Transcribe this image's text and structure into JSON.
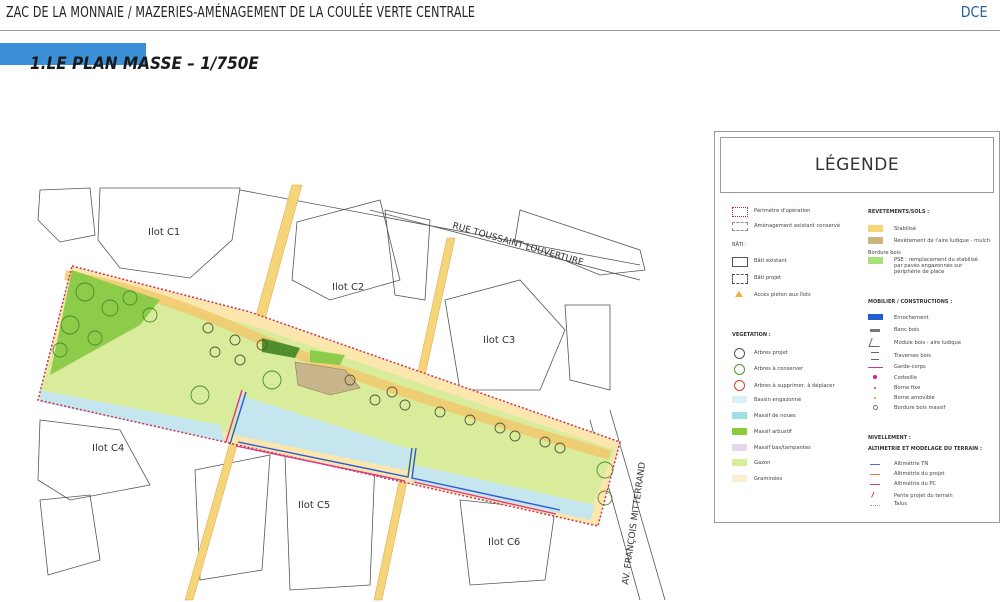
{
  "header": {
    "title": "ZAC DE LA MONNAIE / MAZERIES-AMÉNAGEMENT DE LA COULÉE VERTE CENTRALE",
    "code": "DCE"
  },
  "section": {
    "title": "1.LE PLAN MASSE – 1/750E"
  },
  "plan": {
    "lots": [
      "Ilot C1",
      "Ilot C2",
      "Ilot C3",
      "Ilot C4",
      "Ilot C5",
      "Ilot C6"
    ],
    "street_1": "RUE TOUSSAINT LOUVERTURE",
    "street_2": "AV. FRANÇOIS MITTERRAND"
  },
  "legend": {
    "title": "LÉGENDE",
    "general": [
      {
        "label": "Périmètre d'opération"
      },
      {
        "label": "Aménagement existant conservé"
      }
    ],
    "bati_heading": "BÂTI :",
    "bati": [
      {
        "label": "Bâti existant"
      },
      {
        "label": "Bâti projet"
      },
      {
        "label": "Accès piéton aux îlots"
      }
    ],
    "vegetation_heading": "VEGETATION :",
    "vegetation": [
      {
        "label": "Arbres projet"
      },
      {
        "label": "Arbres à conserver"
      },
      {
        "label": "Arbres à supprimer, à déplacer"
      },
      {
        "label": "Bassin engazonné"
      },
      {
        "label": "Massif de noues"
      },
      {
        "label": "Massif arbustif"
      },
      {
        "label": "Massif bas/tampantes"
      },
      {
        "label": "Gazon"
      },
      {
        "label": "Graminées"
      }
    ],
    "revetements_heading": "REVETEMENTS/SOLS :",
    "revetements": [
      {
        "label": "Stabilisé"
      },
      {
        "label": "Revêtement de l'aire ludique - mulch"
      },
      {
        "label": "Bordure bois"
      },
      {
        "label": "PSE : remplacement du stabilisé"
      },
      {
        "label": "par pavés engazonnés sur"
      },
      {
        "label": "périphérie de place"
      }
    ],
    "mobilier_heading": "MOBILIER / CONSTRUCTIONS :",
    "mobilier": [
      {
        "label": "Enrochement"
      },
      {
        "label": "Banc bois"
      },
      {
        "label": "Module bois - aire ludique"
      },
      {
        "label": "Traverses bois"
      },
      {
        "label": "Garde-corps"
      },
      {
        "label": "Corbeille"
      },
      {
        "label": "Borne fixe"
      },
      {
        "label": "Borne amovible"
      },
      {
        "label": "Bordure bois massif"
      }
    ],
    "nivellement_heading": "NIVELLEMENT :",
    "altimetrie_heading": "ALTIMETRIE ET MODELAGE DU TERRAIN :",
    "altimetrie": [
      {
        "label": "Altimétrie TN"
      },
      {
        "label": "Altimétrie du projet"
      },
      {
        "label": "Altimétrie du PC"
      },
      {
        "label": "Pente projet du terrain"
      },
      {
        "label": "Talus"
      }
    ]
  }
}
